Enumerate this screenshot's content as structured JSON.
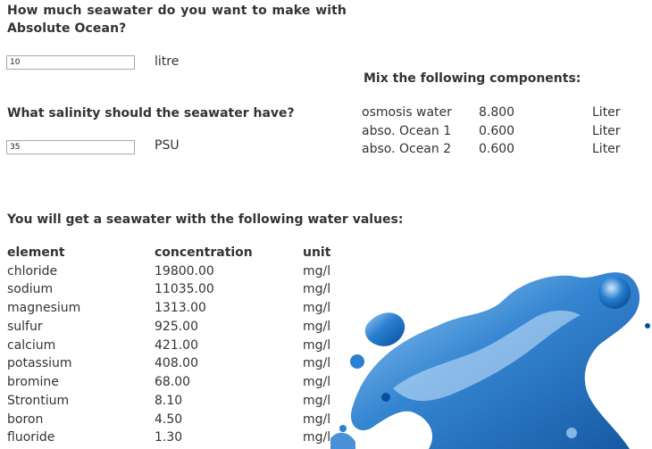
{
  "volume": {
    "question": "How much seawater do you want to make with Absolute Ocean?",
    "value": "10",
    "unit": "litre"
  },
  "salinity": {
    "question": "What salinity should the seawater have?",
    "value": "35",
    "unit": "PSU"
  },
  "mix": {
    "title": "Mix the following components:",
    "rows": [
      {
        "name": "osmosis water",
        "amount": "8.800",
        "unit": "Liter"
      },
      {
        "name": "abso. Ocean 1",
        "amount": "0.600",
        "unit": "Liter"
      },
      {
        "name": "abso. Ocean 2",
        "amount": "0.600",
        "unit": "Liter"
      }
    ]
  },
  "result": {
    "title": "You will get a seawater with the following water values:",
    "headers": {
      "element": "element",
      "concentration": "concentration",
      "unit": "unit"
    },
    "rows": [
      {
        "element": "chloride",
        "concentration": "19800.00",
        "unit": "mg/l"
      },
      {
        "element": "sodium",
        "concentration": "11035.00",
        "unit": "mg/l"
      },
      {
        "element": "magnesium",
        "concentration": "1313.00",
        "unit": "mg/l"
      },
      {
        "element": "sulfur",
        "concentration": "925.00",
        "unit": "mg/l"
      },
      {
        "element": "calcium",
        "concentration": "421.00",
        "unit": "mg/l"
      },
      {
        "element": "potassium",
        "concentration": "408.00",
        "unit": "mg/l"
      },
      {
        "element": "bromine",
        "concentration": "68.00",
        "unit": "mg/l"
      },
      {
        "element": "Strontium",
        "concentration": "8.10",
        "unit": "mg/l"
      },
      {
        "element": "boron",
        "concentration": "4.50",
        "unit": "mg/l"
      },
      {
        "element": "fluoride",
        "concentration": "1.30",
        "unit": "mg/l"
      }
    ]
  },
  "colors": {
    "text": "#333333",
    "water_dark": "#0a4f9c",
    "water_mid": "#2a7fd0",
    "water_light": "#9ccdf2"
  }
}
